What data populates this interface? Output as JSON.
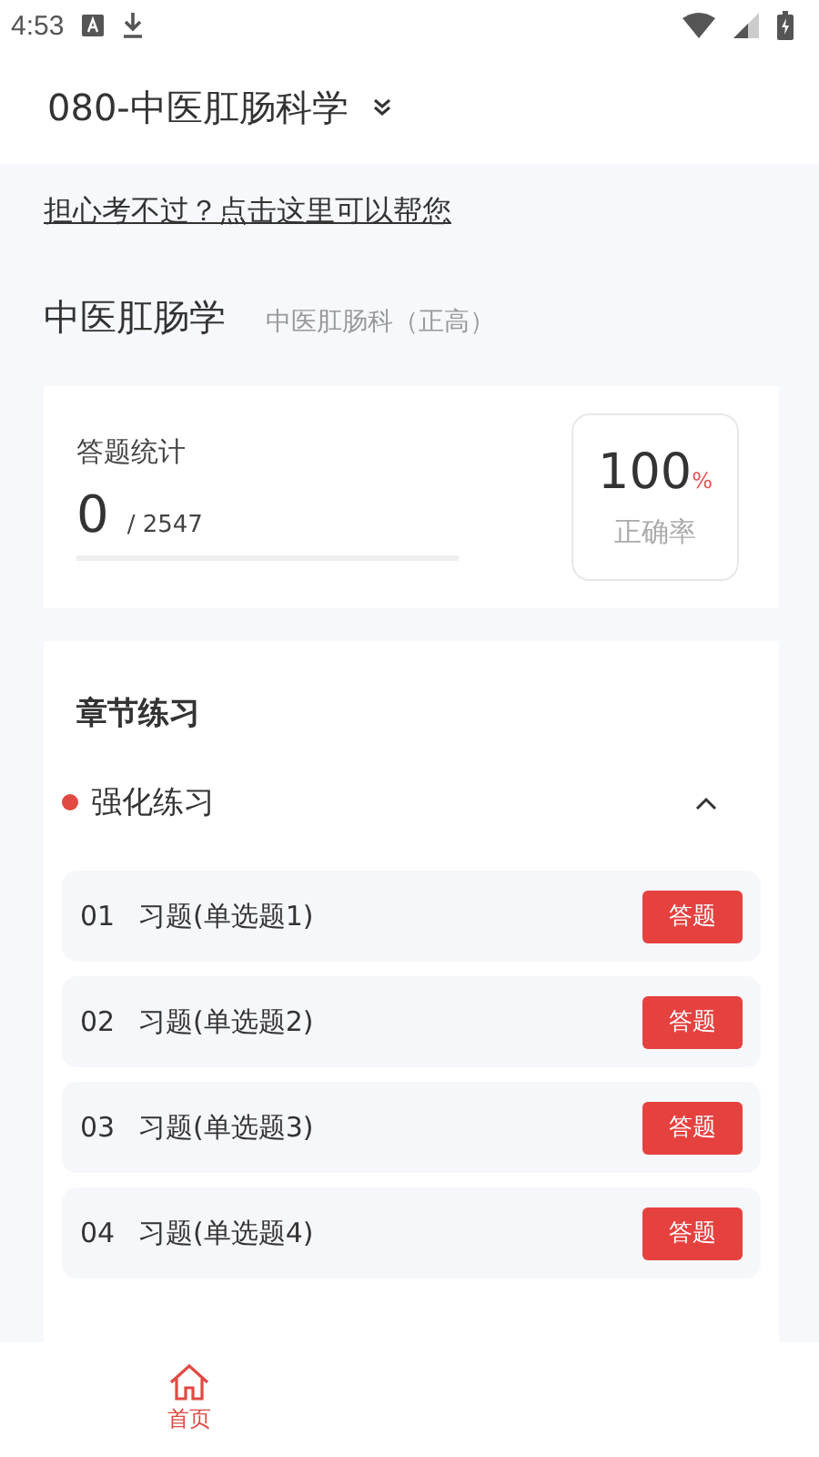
{
  "status_bar": {
    "time": "4:53"
  },
  "header": {
    "title": "080-中医肛肠科学"
  },
  "help_link": "担心考不过？点击这里可以帮您",
  "subject": {
    "name": "中医肛肠学",
    "category": "中医肛肠科（正高）"
  },
  "stats": {
    "label": "答题统计",
    "answered": "0",
    "total": "/ 2547",
    "level": 0,
    "accuracy": "100",
    "accuracy_unit": "%",
    "accuracy_label": "正确率"
  },
  "chapters": {
    "title": "章节练习",
    "section": {
      "name": "强化练习",
      "expanded": true
    },
    "items": [
      {
        "number": "01",
        "name": "习题(单选题1)",
        "action": "答题"
      },
      {
        "number": "02",
        "name": "习题(单选题2)",
        "action": "答题"
      },
      {
        "number": "03",
        "name": "习题(单选题3)",
        "action": "答题"
      },
      {
        "number": "04",
        "name": "习题(单选题4)",
        "action": "答题"
      }
    ]
  },
  "bottom_nav": [
    {
      "label": "首页",
      "selected": true
    }
  ]
}
